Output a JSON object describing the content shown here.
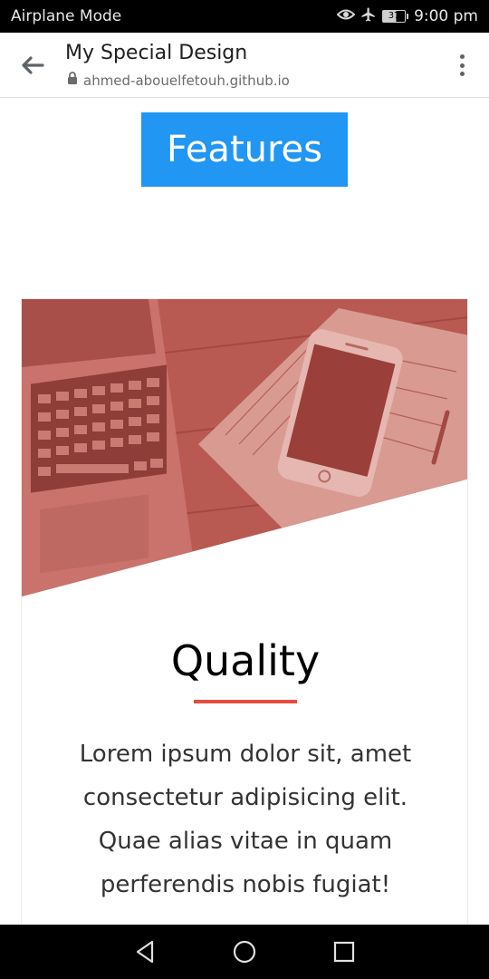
{
  "status_bar": {
    "left_text": "Airplane Mode",
    "battery_level": "37",
    "time": "9:00 pm",
    "icons": [
      "eye-comfort-icon",
      "airplane-icon",
      "battery-icon"
    ]
  },
  "browser": {
    "page_title": "My Special Design",
    "url": "ahmed-abouelfetouh.github.io",
    "icons": [
      "back-arrow-icon",
      "lock-icon",
      "overflow-menu-icon"
    ]
  },
  "content": {
    "heading": "Features",
    "card": {
      "title": "Quality",
      "text": "Lorem ipsum dolor sit, amet consectetur adipisicing elit. Quae alias vitae in quam perferendis nobis fugiat!"
    }
  },
  "navigation": {
    "icons": [
      "nav-back-icon",
      "nav-home-icon",
      "nav-recents-icon"
    ]
  },
  "colors": {
    "heading_bg": "#2196f3",
    "accent": "#e74c3c",
    "image_overlay": "#c0504a"
  }
}
